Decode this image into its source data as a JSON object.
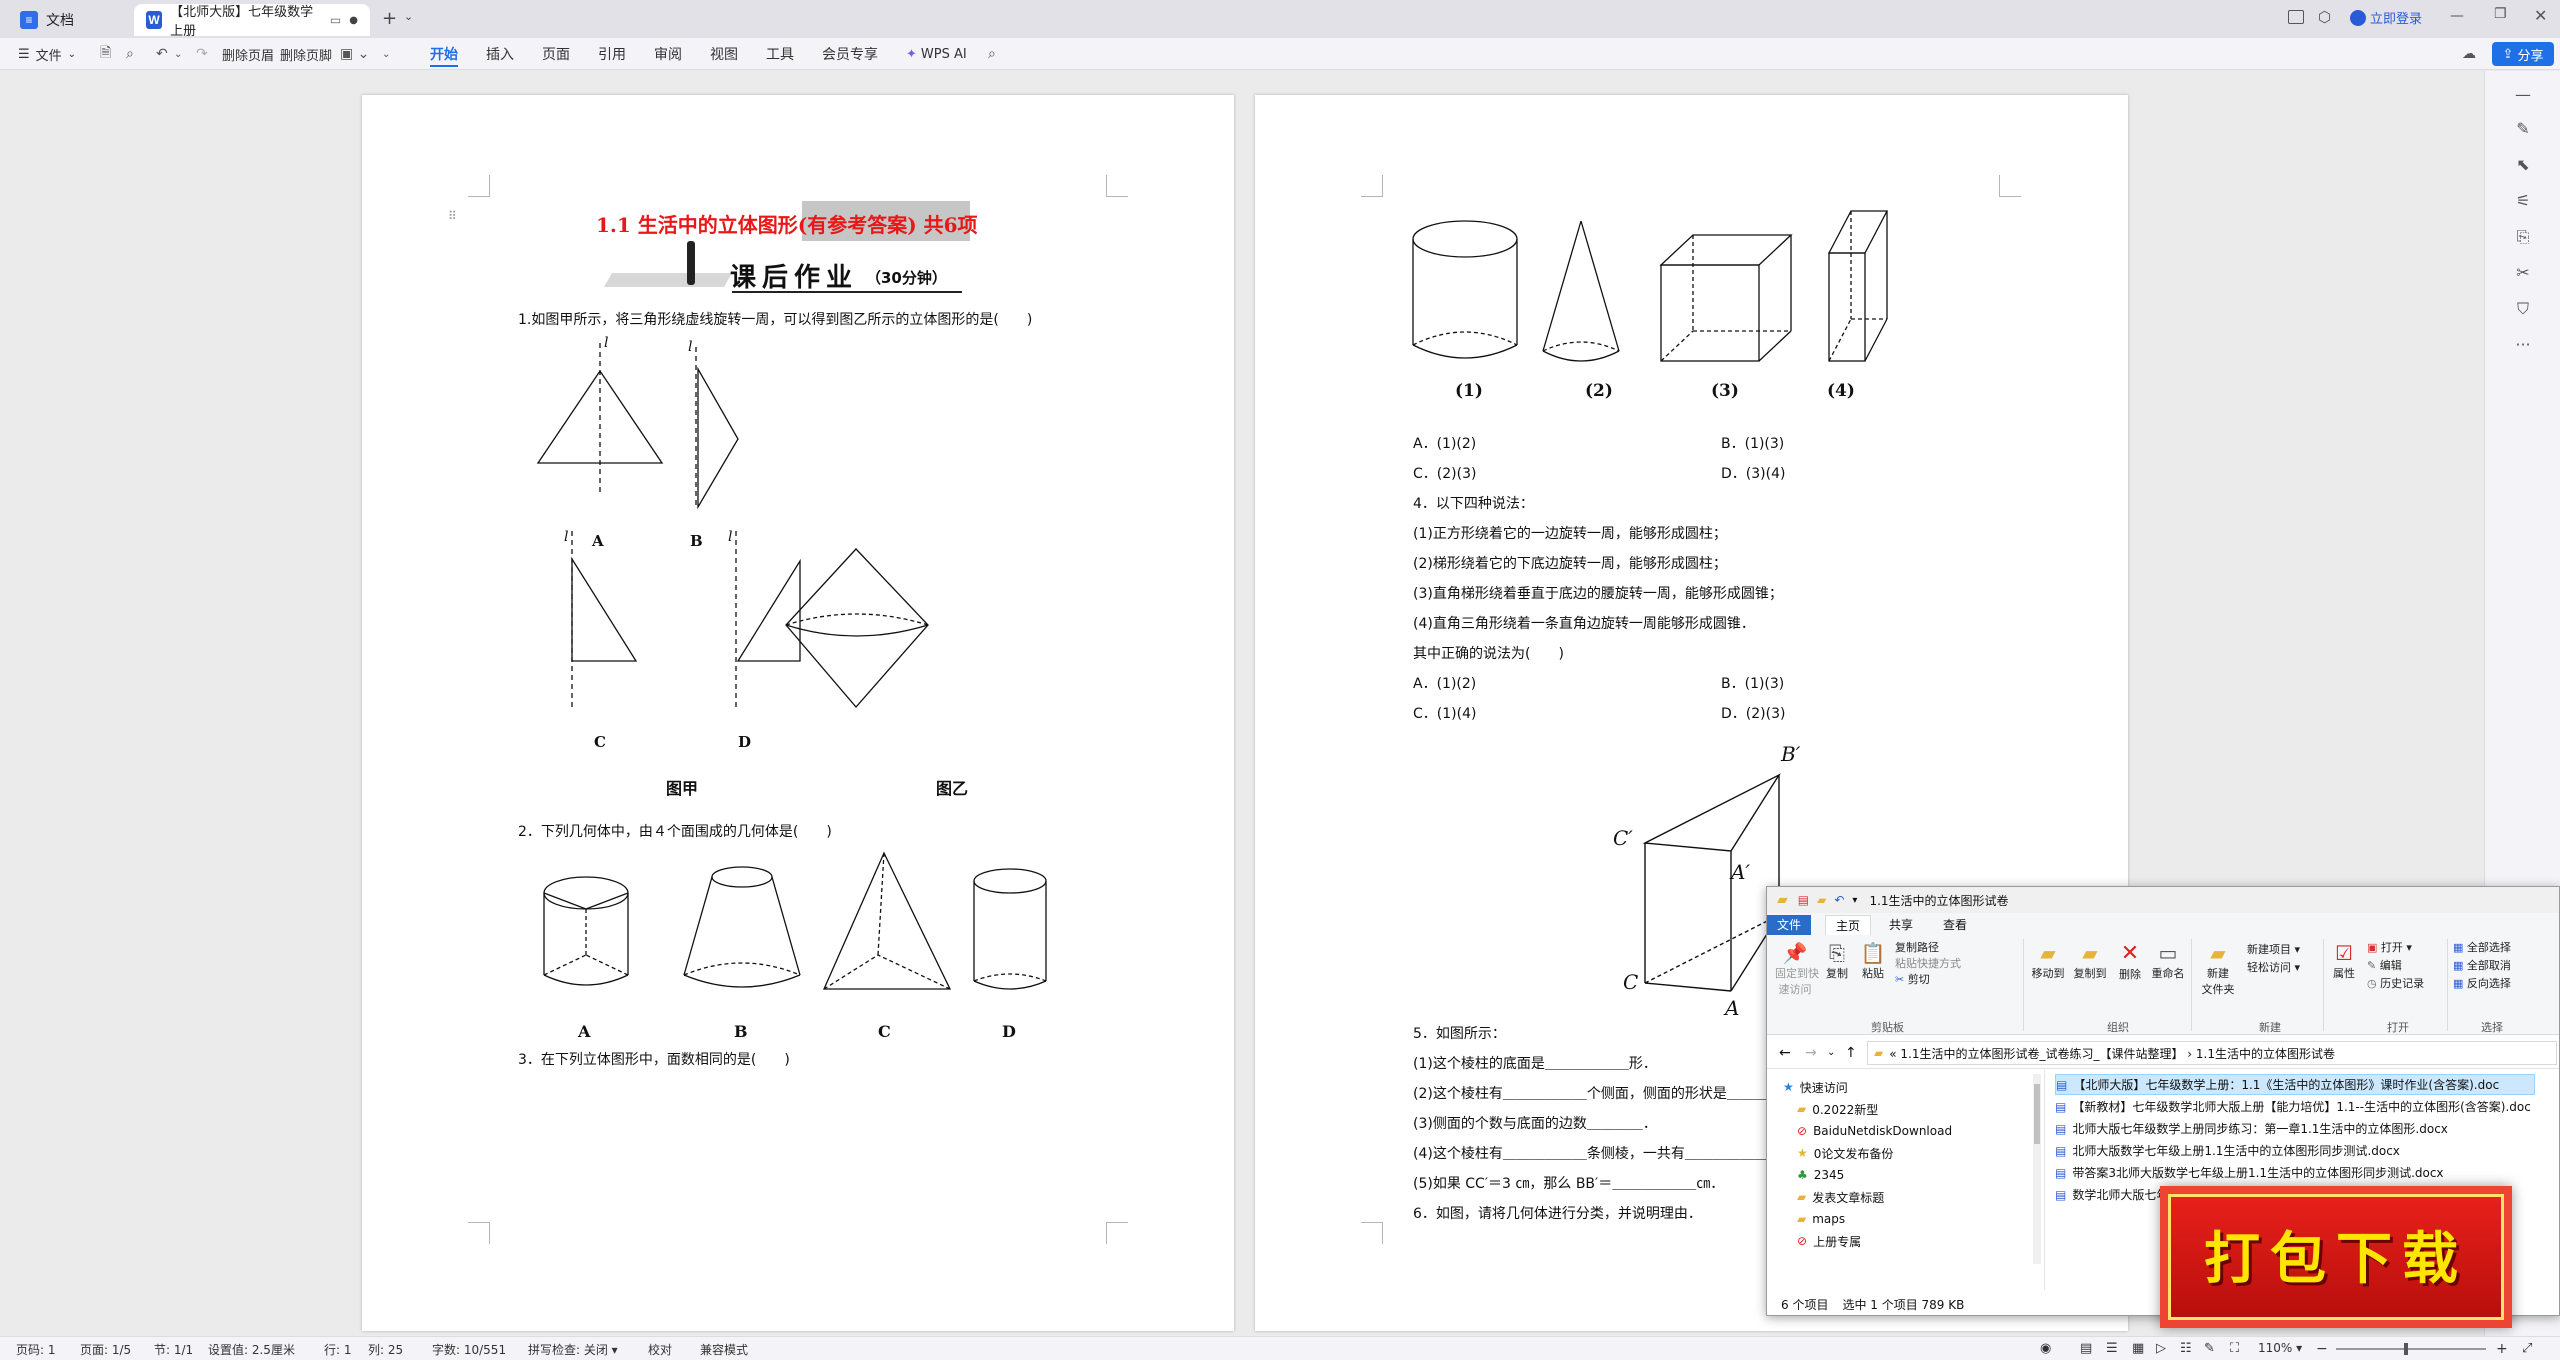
{
  "titlebar": {
    "home_tab": "文档",
    "doc_tab": "【北师大版】七年级数学上册",
    "login": "立即登录"
  },
  "toolbar": {
    "file": "文件",
    "delete_header": "删除页眉",
    "delete_footer": "删除页脚",
    "tabs": [
      "开始",
      "插入",
      "页面",
      "引用",
      "审阅",
      "视图",
      "工具",
      "会员专享"
    ],
    "wps_ai": "WPS AI",
    "share": "分享"
  },
  "page1": {
    "title": "1.1 生活中的立体图形(有参考答案) 共6项",
    "homework": "课后作业",
    "time": "（30分钟）",
    "q1": "1.如图甲所示，将三角形绕虚线旋转一周，可以得到图乙所示的立体图形的是(　　)",
    "fig1_labels": [
      "A",
      "B",
      "C",
      "D"
    ],
    "axis_label": "l",
    "fig_jia": "图甲",
    "fig_yi": "图乙",
    "q2": "2．下列几何体中，由４个面围成的几何体是(　　)",
    "fig2_labels": [
      "A",
      "B",
      "C",
      "D"
    ],
    "q3": "3．在下列立体图形中，面数相同的是(　　)"
  },
  "page2": {
    "shape_labels": [
      "(1)",
      "(2)",
      "(3)",
      "(4)"
    ],
    "q3_options": [
      "A．(1)(2)",
      "B．(1)(3)",
      "C．(2)(3)",
      "D．(3)(4)"
    ],
    "q4": "4．以下四种说法：",
    "q4_items": [
      "(1)正方形绕着它的一边旋转一周，能够形成圆柱；",
      "(2)梯形绕着它的下底边旋转一周，能够形成圆柱；",
      "(3)直角梯形绕着垂直于底边的腰旋转一周，能够形成圆锥；",
      "(4)直角三角形绕着一条直角边旋转一周能够形成圆锥．"
    ],
    "q4_ask": "其中正确的说法为(　　)",
    "q4_options": [
      "A．(1)(2)",
      "B．(1)(3)",
      "C．(1)(4)",
      "D．(2)(3)"
    ],
    "prism_labels": [
      "B′",
      "C′",
      "A′",
      "C",
      "A"
    ],
    "q5": "5．如图所示：",
    "q5_items": [
      "(1)这个棱柱的底面是＿＿＿＿＿＿形．",
      "(2)这个棱柱有＿＿＿＿＿＿个侧面，侧面的形状是＿＿＿",
      "(3)侧面的个数与底面的边数＿＿＿＿．",
      "(4)这个棱柱有＿＿＿＿＿＿条侧棱，一共有＿＿＿＿＿＿条棱",
      "(5)如果 CC′＝3 ㎝，那么 BB′＝＿＿＿＿＿＿㎝．"
    ],
    "q6": "6．如图，请将几何体进行分类，并说明理由．"
  },
  "explorer": {
    "title": "1.1生活中的立体图形试卷",
    "tabs": [
      "文件",
      "主页",
      "共享",
      "查看"
    ],
    "ribbon": {
      "pin": "固定到快\n速访问",
      "copy": "复制",
      "paste": "粘贴",
      "copy_path": "复制路径",
      "paste_shortcut": "粘贴快捷方式",
      "cut": "剪切",
      "move_to": "移动到",
      "copy_to": "复制到",
      "delete": "删除",
      "rename": "重命名",
      "new_folder": "新建\n文件夹",
      "new_item": "新建项目 ▾",
      "easy_access": "轻松访问 ▾",
      "properties": "属性",
      "open": "打开 ▾",
      "edit": "编辑",
      "history": "历史记录",
      "select_all": "全部选择",
      "select_none": "全部取消",
      "invert": "反向选择",
      "g_clipboard": "剪贴板",
      "g_organize": "组织",
      "g_new": "新建",
      "g_open": "打开",
      "g_select": "选择"
    },
    "path": "« 1.1生活中的立体图形试卷_试卷练习_【课件站整理】  ›  1.1生活中的立体图形试卷",
    "nav": [
      "快速访问",
      "0.2022新型",
      "BaiduNetdiskDownload",
      "0论文发布备份",
      "2345",
      "发表文章标题",
      "maps",
      "上册专属"
    ],
    "files": [
      "【北师大版】七年级数学上册：1.1《生活中的立体图形》课时作业(含答案).doc",
      "【新教材】七年级数学北师大版上册【能力培优】1.1--生活中的立体图形(含答案).doc",
      "北师大版七年级数学上册同步练习：第一章1.1生活中的立体图形.docx",
      "北师大版数学七年级上册1.1生活中的立体图形同步测试.docx",
      "带答案3北师大版数学七年级上册1.1生活中的立体图形同步测试.docx",
      "数学北师大版七年级上册1.1生活中的立体图形测试.doc"
    ],
    "status_items": "6 个项目",
    "status_sel": "选中 1 个项目  789 KB"
  },
  "banner": "打包下载",
  "status": {
    "page": "页码: 1",
    "pages": "页面: 1/5",
    "section": "节: 1/1",
    "setting": "设置值: 2.5厘米",
    "row": "行: 1",
    "col": "列: 25",
    "words": "字数: 10/551",
    "spell": "拼写检查: 关闭 ▾",
    "proof": "校对",
    "compat": "兼容模式",
    "zoom": "110%"
  }
}
